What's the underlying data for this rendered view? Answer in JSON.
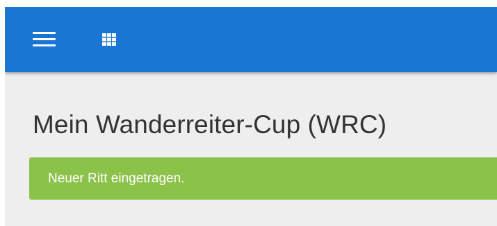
{
  "appbar": {
    "background": "#1976d2",
    "menu_icon": "hamburger-menu-icon",
    "apps_icon": "apps-grid-icon"
  },
  "main": {
    "title": "Mein Wanderreiter-Cup (WRC)",
    "alert": {
      "text": "Neuer Ritt eingetragen.",
      "color": "#8bc34a",
      "type": "success"
    }
  }
}
